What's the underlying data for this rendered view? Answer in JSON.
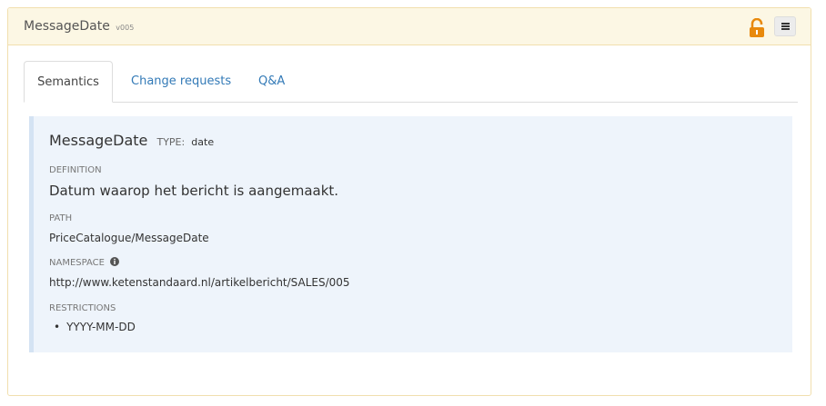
{
  "header": {
    "title": "MessageDate",
    "version": "v005",
    "lock_icon": "unlocked-padlock-icon",
    "menu_icon": "hamburger-menu-icon",
    "accent_color": "#e8890c"
  },
  "tabs": [
    {
      "label": "Semantics",
      "active": true
    },
    {
      "label": "Change requests",
      "active": false
    },
    {
      "label": "Q&A",
      "active": false
    }
  ],
  "semantics": {
    "name": "MessageDate",
    "type_label": "TYPE:",
    "type_value": "date",
    "definition_label": "DEFINITION",
    "definition": "Datum waarop het bericht is aangemaakt.",
    "path_label": "PATH",
    "path": "PriceCatalogue/MessageDate",
    "namespace_label": "NAMESPACE",
    "namespace_icon": "info-circle-icon",
    "namespace": "http://www.ketenstandaard.nl/artikelbericht/SALES/005",
    "restrictions_label": "RESTRICTIONS",
    "restrictions": [
      "YYYY-MM-DD"
    ]
  }
}
